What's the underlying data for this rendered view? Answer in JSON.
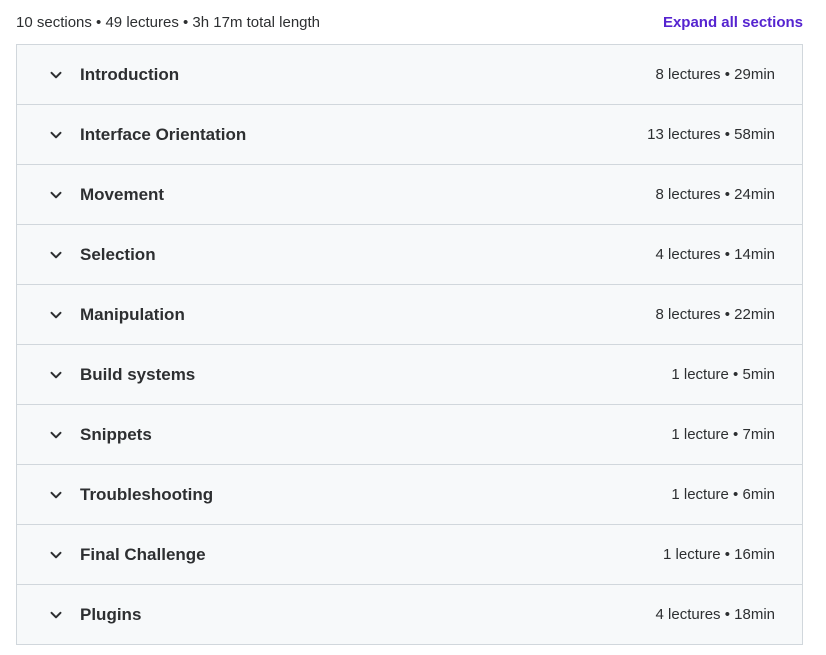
{
  "header": {
    "summary": "10 sections • 49 lectures • 3h 17m total length",
    "expand_label": "Expand all sections"
  },
  "sections": [
    {
      "title": "Introduction",
      "meta": "8 lectures • 29min"
    },
    {
      "title": "Interface Orientation",
      "meta": "13 lectures • 58min"
    },
    {
      "title": "Movement",
      "meta": "8 lectures • 24min"
    },
    {
      "title": "Selection",
      "meta": "4 lectures • 14min"
    },
    {
      "title": "Manipulation",
      "meta": "8 lectures • 22min"
    },
    {
      "title": "Build systems",
      "meta": "1 lecture • 5min"
    },
    {
      "title": "Snippets",
      "meta": "1 lecture • 7min"
    },
    {
      "title": "Troubleshooting",
      "meta": "1 lecture • 6min"
    },
    {
      "title": "Final Challenge",
      "meta": "1 lecture • 16min"
    },
    {
      "title": "Plugins",
      "meta": "4 lectures • 18min"
    }
  ],
  "colors": {
    "accent": "#5624d0",
    "row_bg": "#f7f9fa",
    "border": "#d1d7dc",
    "text": "#2d2f31"
  },
  "icons": {
    "expand": "chevron-down-icon"
  }
}
